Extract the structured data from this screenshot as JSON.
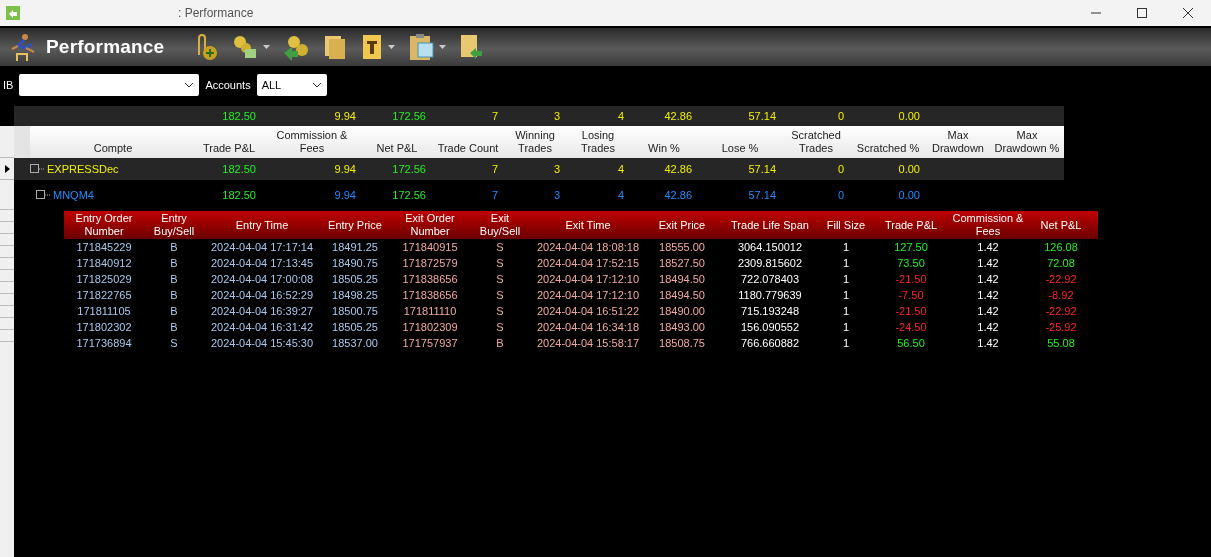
{
  "window": {
    "title": ": Performance"
  },
  "toolbar": {
    "title": "Performance"
  },
  "filters": {
    "ib_label": "IB",
    "accounts_label": "Accounts",
    "accounts_value": "ALL"
  },
  "summary": {
    "columns": [
      "Compte",
      "Trade P&L",
      "Commission & Fees",
      "Net P&L",
      "Trade Count",
      "Winning Trades",
      "Losing Trades",
      "Win %",
      "Lose %",
      "Scratched Trades",
      "Scratched %",
      "Max Drawdown",
      "Max Drawdown %"
    ],
    "totals": [
      "182.50",
      "9.94",
      "172.56",
      "7",
      "3",
      "4",
      "42.86",
      "57.14",
      "0",
      "0.00"
    ],
    "rows": [
      {
        "kind": "account",
        "selected": true,
        "name": "EXPRESSDec",
        "values": [
          "182.50",
          "9.94",
          "172.56",
          "7",
          "3",
          "4",
          "42.86",
          "57.14",
          "0",
          "0.00"
        ]
      },
      {
        "kind": "instrument",
        "selected": false,
        "name": "MNQM4",
        "values": [
          "182.50",
          "9.94",
          "172.56",
          "7",
          "3",
          "4",
          "42.86",
          "57.14",
          "0",
          "0.00"
        ]
      }
    ]
  },
  "trades": {
    "columns": [
      "Entry Order Number",
      "Entry Buy/Sell",
      "Entry Time",
      "Entry Price",
      "Exit Order Number",
      "Exit Buy/Sell",
      "Exit Time",
      "Exit Price",
      "Trade Life Span",
      "Fill Size",
      "Trade P&L",
      "Commission & Fees",
      "Net P&L"
    ],
    "rows": [
      {
        "color": "#22ee22",
        "cells": [
          "171845229",
          "B",
          "2024-04-04 17:17:14",
          "18491.25",
          "171840915",
          "S",
          "2024-04-04 18:08:18",
          "18555.00",
          "3064.150012",
          "1",
          "127.50",
          "1.42",
          "126.08"
        ]
      },
      {
        "color": "#22ee22",
        "cells": [
          "171840912",
          "B",
          "2024-04-04 17:13:45",
          "18490.75",
          "171872579",
          "S",
          "2024-04-04 17:52:15",
          "18527.50",
          "2309.815602",
          "1",
          "73.50",
          "1.42",
          "72.08"
        ]
      },
      {
        "color": "#ff2020",
        "cells": [
          "171825029",
          "B",
          "2024-04-04 17:00:08",
          "18505.25",
          "171838656",
          "S",
          "2024-04-04 17:12:10",
          "18494.50",
          "722.078403",
          "1",
          "-21.50",
          "1.42",
          "-22.92"
        ]
      },
      {
        "color": "#ff2020",
        "cells": [
          "171822765",
          "B",
          "2024-04-04 16:52:29",
          "18498.25",
          "171838656",
          "S",
          "2024-04-04 17:12:10",
          "18494.50",
          "1180.779639",
          "1",
          "-7.50",
          "1.42",
          "-8.92"
        ]
      },
      {
        "color": "#ff2020",
        "cells": [
          "171811105",
          "B",
          "2024-04-04 16:39:27",
          "18500.75",
          "171811110",
          "S",
          "2024-04-04 16:51:22",
          "18490.00",
          "715.193248",
          "1",
          "-21.50",
          "1.42",
          "-22.92"
        ]
      },
      {
        "color": "#ff2020",
        "cells": [
          "171802302",
          "B",
          "2024-04-04 16:31:42",
          "18505.25",
          "171802309",
          "S",
          "2024-04-04 16:34:18",
          "18493.00",
          "156.090552",
          "1",
          "-24.50",
          "1.42",
          "-25.92"
        ]
      },
      {
        "color": "#22ee22",
        "cells": [
          "171736894",
          "S",
          "2024-04-04 15:45:30",
          "18537.00",
          "171757937",
          "B",
          "2024-04-04 15:58:17",
          "18508.75",
          "766.660882",
          "1",
          "56.50",
          "1.42",
          "55.08"
        ]
      }
    ]
  }
}
